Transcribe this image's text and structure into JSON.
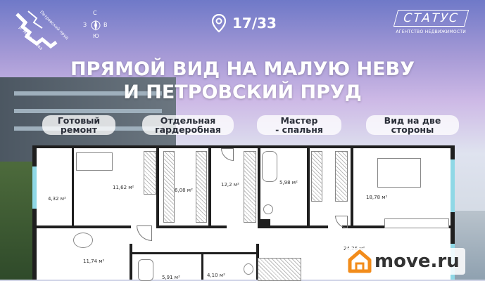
{
  "header": {
    "logo_text_1": "Петровский пруд",
    "logo_text_2": "р. Малая Нева",
    "compass": {
      "n": "С",
      "e": "В",
      "s": "Ю",
      "w": "З"
    },
    "counter": "17/33"
  },
  "brand": {
    "name": "СТАТУС",
    "subtitle": "АГЕНТСТВО НЕДВИЖИМОСТИ"
  },
  "headline": {
    "line1": "ПРЯМОЙ ВИД НА МАЛУЮ НЕВУ",
    "line2": "И ПЕТРОВСКИЙ ПРУД"
  },
  "features": [
    {
      "line1": "Готовый",
      "line2": "ремонт"
    },
    {
      "line1": "Отдельная",
      "line2": "гардеробная"
    },
    {
      "line1": "Мастер",
      "line2": "- спальня"
    },
    {
      "line1": "Вид на две",
      "line2": "стороны"
    }
  ],
  "rooms": [
    "4,32 м²",
    "11,62 м²",
    "6,08 м²",
    "12,2 м²",
    "5,98 м²",
    "18,78 м²",
    "24,26 м²",
    "11,74 м²",
    "5,91 м²",
    "4,10 м²"
  ],
  "watermark": "move.ru",
  "colors": {
    "accent_orange": "#f28c1b",
    "window_blue": "#8fd8e6"
  }
}
